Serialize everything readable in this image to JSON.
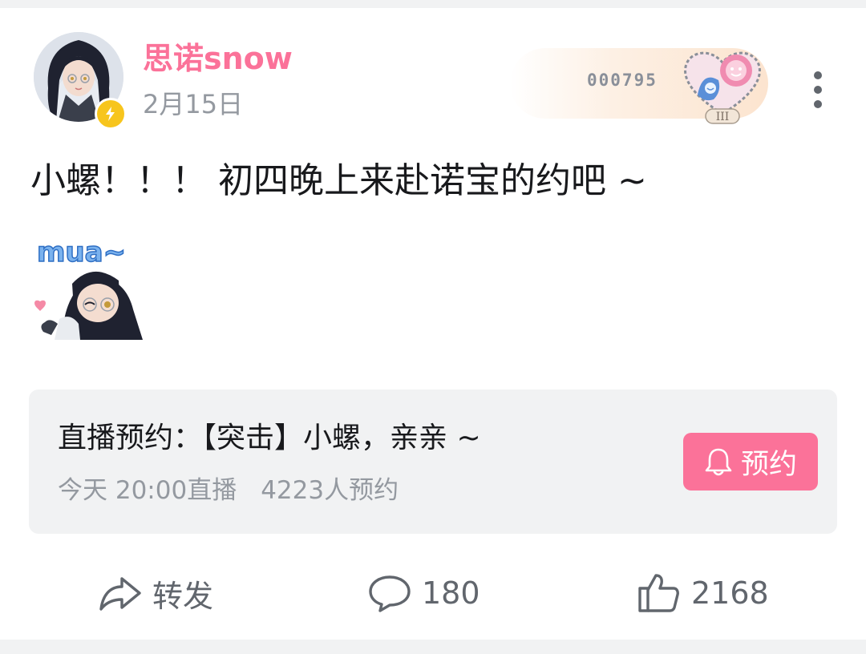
{
  "post": {
    "author": {
      "name": "思诺snow",
      "date": "2月15日",
      "verified_badge": "lightning-icon"
    },
    "fan_medal": {
      "number": "000795",
      "level": "III"
    },
    "text": "小螺！！！ 初四晚上来赴诺宝的约吧 ~",
    "sticker_text": "mua~"
  },
  "live_reservation": {
    "title": "直播预约：【突击】小螺，亲亲 ~",
    "time": "今天 20:00直播",
    "count": "4223人预约",
    "button_label": "预约",
    "button_icon": "bell-icon"
  },
  "actions": {
    "share_label": "转发",
    "comment_count": "180",
    "like_count": "2168"
  },
  "colors": {
    "accent_pink": "#fb7299",
    "badge_yellow": "#f7c51d",
    "text_primary": "#18191c",
    "text_secondary": "#9499a0",
    "panel_gray": "#f1f2f3"
  }
}
